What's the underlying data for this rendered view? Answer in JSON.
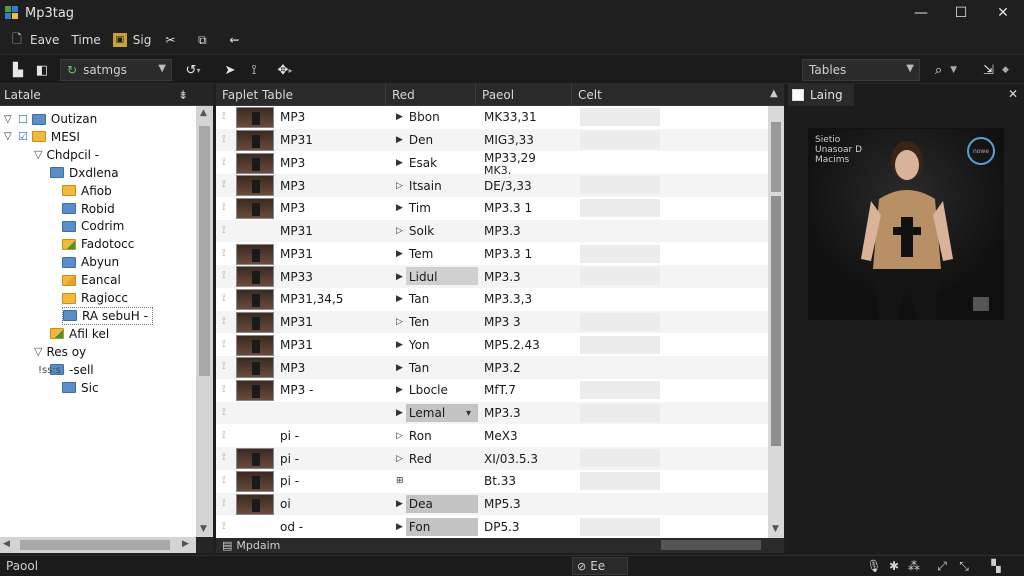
{
  "window": {
    "title": "Mp3tag",
    "min": "—",
    "max": "☐",
    "close": "✕"
  },
  "menu": [
    {
      "label": "Eave",
      "icon": "file-icon"
    },
    {
      "label": "Time",
      "icon": "none"
    },
    {
      "label": "Sig",
      "icon": "save-icon"
    },
    {
      "label": "",
      "icon": "tools-icon"
    },
    {
      "label": "",
      "icon": "export-icon"
    },
    {
      "label": "",
      "icon": "arrow-icon"
    }
  ],
  "toolbar": {
    "settings_combo": "satmgs",
    "tables_combo": "Tables"
  },
  "left_pane": {
    "title": "Latale",
    "pin": "⇟",
    "tree": [
      {
        "label": "Outizan",
        "level": 0,
        "color": "blue",
        "twisty": "▽",
        "check": "☐"
      },
      {
        "label": "MESI",
        "level": 0,
        "color": "yellow",
        "twisty": "▽",
        "check": "☑"
      },
      {
        "label": "Chdpcil -",
        "level": 1,
        "color": "none"
      },
      {
        "label": "Dxdlena",
        "level": 2,
        "color": "blue"
      },
      {
        "label": "Afiob",
        "level": 3,
        "color": "yellow"
      },
      {
        "label": "Robid",
        "level": 3,
        "color": "blue"
      },
      {
        "label": "Codrim",
        "level": 3,
        "color": "blue"
      },
      {
        "label": "Fadotocc",
        "level": 3,
        "color": "green"
      },
      {
        "label": "Abyun",
        "level": 3,
        "color": "blue"
      },
      {
        "label": "Eancal",
        "level": 3,
        "color": "check"
      },
      {
        "label": "Ragiocc",
        "level": 3,
        "color": "yellow"
      },
      {
        "label": "RA sebuH -",
        "level": 3,
        "color": "blue"
      },
      {
        "label": "Afil kel",
        "level": 2,
        "color": "green"
      },
      {
        "label": "Res oy",
        "level": 1,
        "color": "none"
      },
      {
        "label": "-sell",
        "level": 2,
        "color": "blue"
      },
      {
        "label": "Sic",
        "level": 3,
        "color": "blue"
      }
    ],
    "tree_prefix_res": "!ss:s"
  },
  "grid": {
    "columns": [
      "Faplet Table",
      "Red",
      "Paeol",
      "Celt"
    ],
    "rows": [
      {
        "fmt": "MP3",
        "title": "Bbon",
        "val": "MK33,31",
        "arrow": "▶"
      },
      {
        "fmt": "MP31",
        "title": "Den",
        "val": "MIG3,33",
        "arrow": "▶"
      },
      {
        "fmt": "MP3",
        "title": "Esak",
        "val": "MP33,29",
        "val2": "MK3,",
        "arrow": "▶"
      },
      {
        "fmt": "MP3",
        "title": "Itsain",
        "val": "DE/3,33",
        "arrow": "▷"
      },
      {
        "fmt": "MP3",
        "title": "Tim",
        "val": "MP3.3 1",
        "arrow": "▶"
      },
      {
        "fmt": "MP31",
        "title": "Solk",
        "val": "MP3.3",
        "arrow": "▷"
      },
      {
        "fmt": "MP31",
        "title": "Tem",
        "val": "MP3.3 1",
        "arrow": "▶"
      },
      {
        "fmt": "MP33",
        "title": "Lidul",
        "val": "MP3.3",
        "arrow": "▶"
      },
      {
        "fmt": "MP31,34,5",
        "title": "Tan",
        "val": "MP3.3,3",
        "arrow": "▶"
      },
      {
        "fmt": "MP31",
        "title": "Ten",
        "val": "MP3 3",
        "arrow": "▷"
      },
      {
        "fmt": "MP31",
        "title": "Yon",
        "val": "MP5.2.43",
        "arrow": "▶"
      },
      {
        "fmt": "MP3",
        "title": "Tan",
        "val": "MP3.2",
        "arrow": "▶"
      },
      {
        "fmt": "MP3 -",
        "title": "Lbocle",
        "val": "MfT.7",
        "arrow": "▶"
      },
      {
        "fmt": "",
        "title": "Lemal",
        "val": "MP3.3",
        "arrow": "▶",
        "dropdown": "▾"
      },
      {
        "fmt": "pi -",
        "title": "Ron",
        "val": "MeX3",
        "arrow": "▷"
      },
      {
        "fmt": "pi -",
        "title": "Red",
        "val": "XI/03.5.3",
        "arrow": "▷"
      },
      {
        "fmt": "pi -",
        "title": "",
        "val": "Bt.33",
        "arrow": "⊞"
      },
      {
        "fmt": "oi",
        "title": "Dea",
        "val": "MP5.3",
        "arrow": "▶"
      },
      {
        "fmt": "od -",
        "title": "Fon",
        "val": "DP5.3",
        "arrow": "▶"
      }
    ],
    "footer": "Mpdaim"
  },
  "right_pane": {
    "tab_label": "Laing",
    "close": "✕",
    "artwork_text": [
      "Sietio",
      "Unasoar D",
      "Macims"
    ],
    "artwork_badge": "nowe"
  },
  "statusbar": {
    "left_text": "Paool",
    "mid_text": "Ee"
  }
}
